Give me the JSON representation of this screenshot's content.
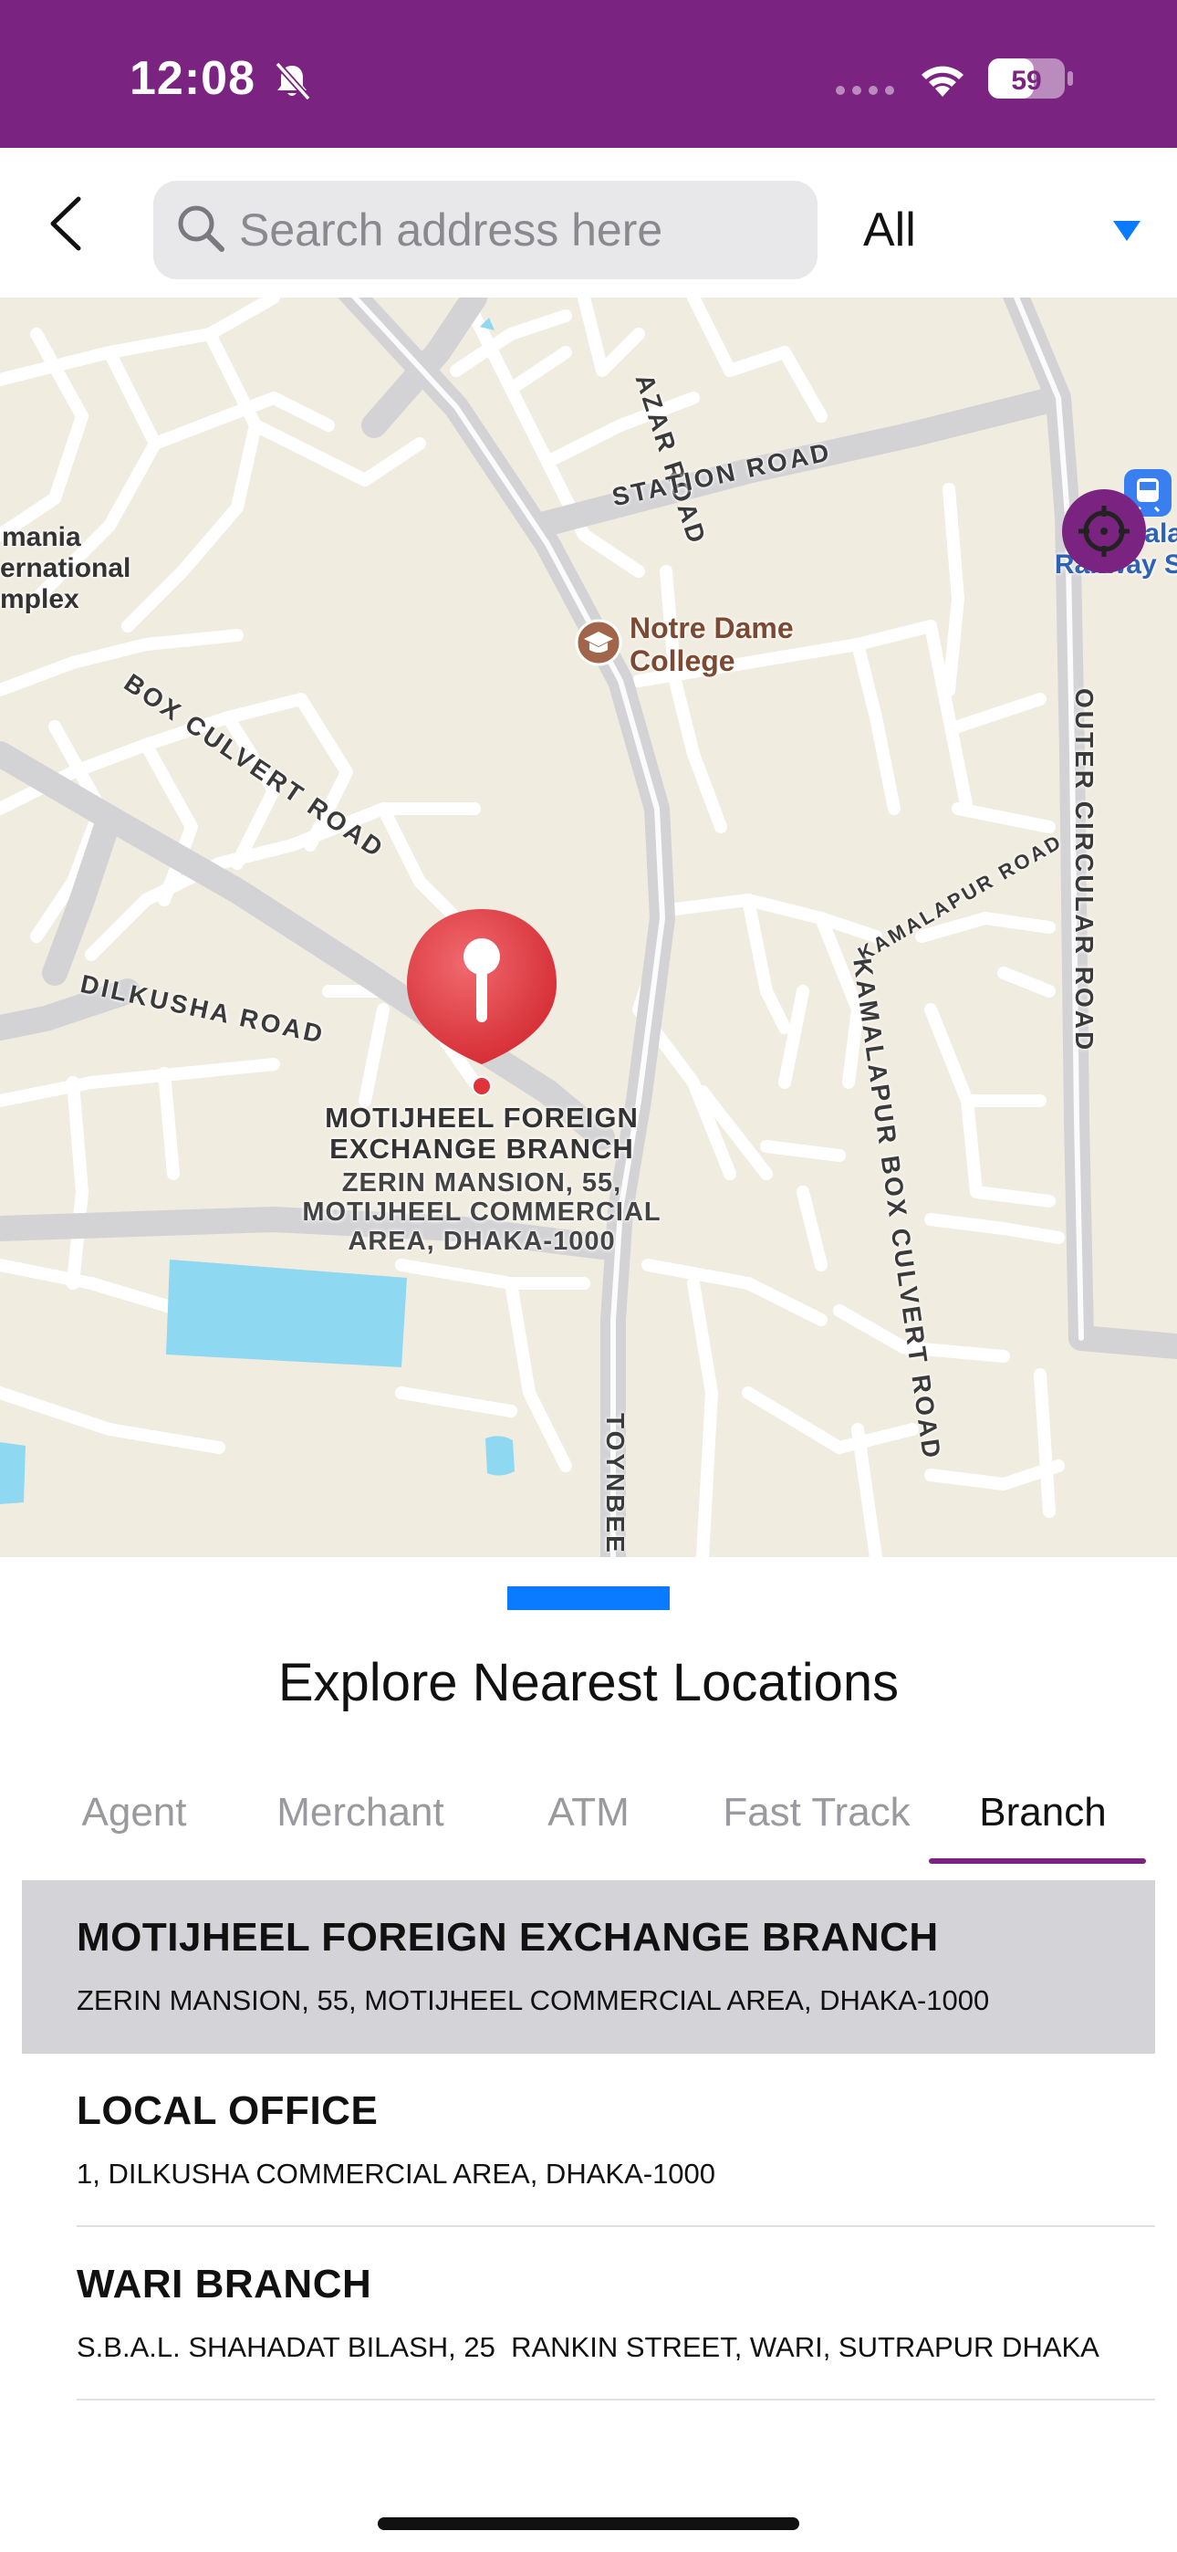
{
  "status_bar": {
    "time": "12:08",
    "battery": "59",
    "background_color": "#7a2380"
  },
  "search": {
    "placeholder": "Search address here",
    "value": "",
    "filter_value": "All"
  },
  "map": {
    "roads": [
      "AZAR ROAD",
      "STATION ROAD",
      "BOX CULVERT ROAD",
      "KAMALAPUR ROAD",
      "OUTER CIRCULAR ROAD",
      "DILKUSHA ROAD",
      "KAMALAPUR BOX CULVERT ROAD",
      "TOYNBEE"
    ],
    "places": {
      "osmania": [
        "mania",
        "ernational",
        "mplex"
      ],
      "college": [
        "Notre Dame",
        "College"
      ],
      "railway": [
        "ala",
        "Railway S"
      ]
    },
    "pin": {
      "title": "MOTIJHEEL FOREIGN EXCHANGE BRANCH",
      "address": "ZERIN MANSION, 55, MOTIJHEEL COMMERCIAL AREA, DHAKA-1000",
      "color": "#e0333a"
    }
  },
  "sheet": {
    "title": "Explore Nearest Locations",
    "tabs": [
      {
        "label": "Agent"
      },
      {
        "label": "Merchant"
      },
      {
        "label": "ATM"
      },
      {
        "label": "Fast Track"
      },
      {
        "label": "Branch"
      }
    ],
    "active_tab": "Branch",
    "accent_color": "#7a2380",
    "handle_color": "#0a7aff",
    "locations": [
      {
        "name": "MOTIJHEEL FOREIGN EXCHANGE BRANCH",
        "address": "ZERIN MANSION, 55, MOTIJHEEL COMMERCIAL AREA, DHAKA-1000",
        "selected": true
      },
      {
        "name": "LOCAL OFFICE",
        "address": "1, DILKUSHA COMMERCIAL AREA, DHAKA-1000",
        "selected": false
      },
      {
        "name": "WARI BRANCH",
        "address": "S.B.A.L. SHAHADAT BILASH, 25  RANKIN STREET, WARI, SUTRAPUR DHAKA",
        "selected": false
      }
    ]
  }
}
